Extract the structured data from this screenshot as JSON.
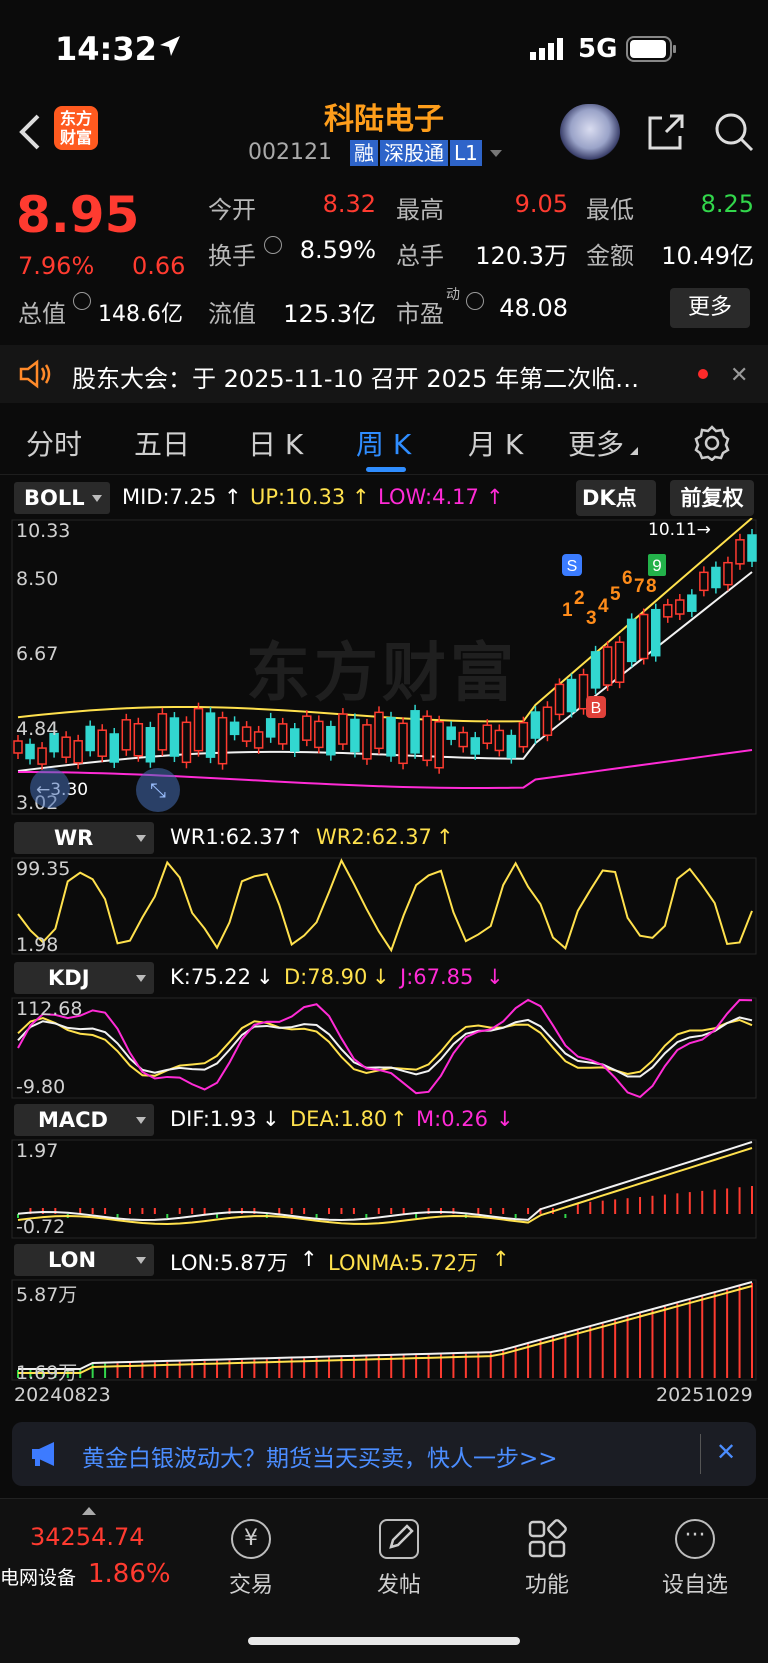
{
  "status": {
    "time": "14:32",
    "network": "5G"
  },
  "header": {
    "logo_text": "东方\n财富",
    "title": "科陆电子",
    "code": "002121",
    "tags": [
      "融",
      "深股通",
      "L1"
    ]
  },
  "quote": {
    "price": "8.95",
    "pct": "7.96%",
    "change": "0.66",
    "labels": {
      "open": "今开",
      "high": "最高",
      "low": "最低",
      "turnover": "换手",
      "volume": "总手",
      "amount": "金额",
      "total_cap": "总值",
      "float_cap": "流值",
      "pe": "市盈",
      "pe_sup": "动"
    },
    "values": {
      "open": "8.32",
      "high": "9.05",
      "low": "8.25",
      "turnover": "8.59%",
      "volume": "120.3万",
      "amount": "10.49亿",
      "total_cap": "148.6亿",
      "float_cap": "125.3亿",
      "pe": "48.08"
    },
    "more": "更多"
  },
  "notice": {
    "text": "股东大会：于 2025-11-10 召开 2025 年第二次临…"
  },
  "tabs": [
    "分时",
    "五日",
    "日 K",
    "周 K",
    "月 K",
    "更多"
  ],
  "active_tab": "周 K",
  "boll": {
    "name": "BOLL",
    "mid": "MID:7.25",
    "up": "UP:10.33",
    "low": "LOW:4.17",
    "dk": "DK点",
    "adj": "前复权",
    "axis": [
      "10.33",
      "8.50",
      "6.67",
      "4.84",
      "3.02"
    ],
    "max_label": "10.11→",
    "min_label": "←3.30",
    "watermark": "东方财富",
    "signals": [
      "S",
      "B",
      "1",
      "2",
      "3",
      "4",
      "5",
      "6",
      "7",
      "8",
      "9"
    ]
  },
  "wr": {
    "name": "WR",
    "wr1": "WR1:62.37",
    "wr2": "WR2:62.37",
    "axis": [
      "99.35",
      "1.98"
    ]
  },
  "kdj": {
    "name": "KDJ",
    "k": "K:75.22",
    "d": "D:78.90",
    "j": "J:67.85",
    "axis": [
      "112.68",
      "-9.80"
    ]
  },
  "macd": {
    "name": "MACD",
    "dif": "DIF:1.93",
    "dea": "DEA:1.80",
    "m": "M:0.26",
    "axis": [
      "1.97",
      "-0.72"
    ]
  },
  "lon": {
    "name": "LON",
    "lon": "LON:5.87万",
    "lonma": "LONMA:5.72万",
    "axis": [
      "5.87万",
      "1.69万"
    ]
  },
  "dates": {
    "start": "20240823",
    "end": "20251029"
  },
  "banner": {
    "text": "黄金白银波动大？期货当天买卖，快人一步>>"
  },
  "bottom": {
    "index_value": "34254.74",
    "index_name": "电网设备",
    "index_pct": "1.86%",
    "nav": [
      "交易",
      "发帖",
      "功能",
      "设自选"
    ]
  },
  "colors": {
    "up": "#ff3b30",
    "down": "#32d74b",
    "accent": "#2f8dff",
    "yellow": "#ffe14d",
    "magenta": "#ff2bd6"
  }
}
